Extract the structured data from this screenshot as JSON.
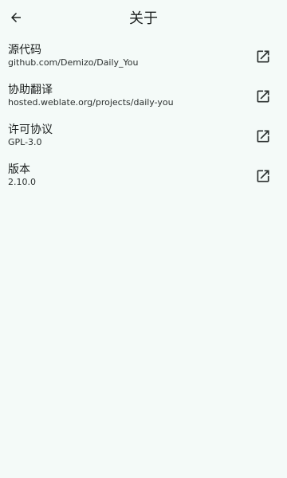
{
  "appbar": {
    "title": "关于",
    "back_icon": "arrow-back-icon"
  },
  "items": [
    {
      "title": "源代码",
      "subtitle": "github.com/Demizo/Daily_You",
      "icon": "open-in-new-icon"
    },
    {
      "title": "协助翻译",
      "subtitle": "hosted.weblate.org/projects/daily-you",
      "icon": "open-in-new-icon"
    },
    {
      "title": "许可协议",
      "subtitle": "GPL-3.0",
      "icon": "open-in-new-icon"
    },
    {
      "title": "版本",
      "subtitle": "2.10.0",
      "icon": "open-in-new-icon"
    }
  ],
  "colors": {
    "background": "#f4faf8",
    "text": "#1b1f1e",
    "icon": "#2b302f"
  }
}
